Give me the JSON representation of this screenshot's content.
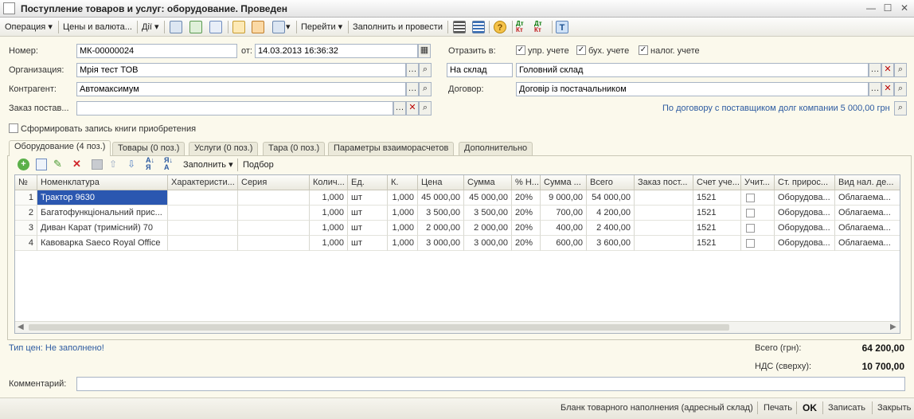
{
  "window": {
    "title": "Поступление товаров и услуг: оборудование. Проведен"
  },
  "toolbar": {
    "operation": "Операция",
    "prices": "Цены и валюта...",
    "actions": "Дії",
    "goto": "Перейти",
    "fill_post": "Заполнить и провести"
  },
  "header": {
    "number_label": "Номер:",
    "number_value": "МК-00000024",
    "date_label": "от:",
    "date_value": "14.03.2013 16:36:32",
    "org_label": "Организация:",
    "org_value": "Мрія тест ТОВ",
    "contractor_label": "Контрагент:",
    "contractor_value": "Автомаксимум",
    "order_label": "Заказ постав...",
    "order_value": "",
    "reflect_label": "Отразить в:",
    "reflect": [
      {
        "label": "упр. учете",
        "checked": true
      },
      {
        "label": "бух. учете",
        "checked": true
      },
      {
        "label": "налог. учете",
        "checked": true
      }
    ],
    "warehouse_type": "На склад",
    "warehouse_value": "Головний склад",
    "contract_label": "Договор:",
    "contract_value": "Договір із постачальником",
    "debt_link": "По договору с поставщиком долг компании 5 000,00 грн",
    "book_checkbox": "Сформировать запись книги приобретения"
  },
  "tabs": [
    "Оборудование (4 поз.)",
    "Товары (0 поз.)",
    "Услуги (0 поз.)",
    "Тара (0 поз.)",
    "Параметры взаиморасчетов",
    "Дополнительно"
  ],
  "table_toolbar": {
    "fill": "Заполнить",
    "select": "Подбор"
  },
  "table": {
    "columns": [
      "№",
      "Номенклатура",
      "Характеристи...",
      "Серия",
      "Колич...",
      "Ед.",
      "К.",
      "Цена",
      "Сумма",
      "% Н...",
      "Сумма ...",
      "Всего",
      "Заказ пост...",
      "Счет уче...",
      "Учит...",
      "Ст. прирос...",
      "Вид нал. де..."
    ],
    "rows": [
      [
        "1",
        "Трактор 9630",
        "",
        "",
        "1,000",
        "шт",
        "1,000",
        "45 000,00",
        "45 000,00",
        "20%",
        "9 000,00",
        "54 000,00",
        "",
        "1521",
        "",
        "Оборудова...",
        "Облагаема..."
      ],
      [
        "2",
        "Багатофункціональний прис...",
        "",
        "",
        "1,000",
        "шт",
        "1,000",
        "3 500,00",
        "3 500,00",
        "20%",
        "700,00",
        "4 200,00",
        "",
        "1521",
        "",
        "Оборудова...",
        "Облагаема..."
      ],
      [
        "3",
        "Диван Карат (тримісний) 70",
        "",
        "",
        "1,000",
        "шт",
        "1,000",
        "2 000,00",
        "2 000,00",
        "20%",
        "400,00",
        "2 400,00",
        "",
        "1521",
        "",
        "Оборудова...",
        "Облагаема..."
      ],
      [
        "4",
        "Кавоварка Saeco Royal Office",
        "",
        "",
        "1,000",
        "шт",
        "1,000",
        "3 000,00",
        "3 000,00",
        "20%",
        "600,00",
        "3 600,00",
        "",
        "1521",
        "",
        "Оборудова...",
        "Облагаема..."
      ]
    ]
  },
  "footer": {
    "price_type": "Тип цен: Не заполнено!",
    "total_label": "Всего (грн):",
    "total_value": "64 200,00",
    "vat_label": "НДС (сверху):",
    "vat_value": "10 700,00",
    "comment_label": "Комментарий:",
    "comment_value": ""
  },
  "bottom_bar": {
    "blank": "Бланк товарного наполнения (адресный склад)",
    "print": "Печать",
    "ok": "OK",
    "save": "Записать",
    "close": "Закрыть"
  },
  "colors": {
    "background": "#fbf9ec",
    "link": "#2c5aa0",
    "selection": "#2b57b0"
  }
}
